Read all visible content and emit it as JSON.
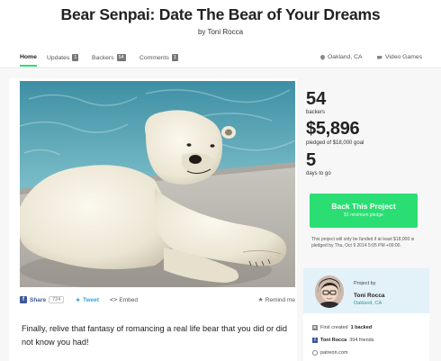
{
  "project": {
    "title": "Bear Senpai: Date The Bear of Your Dreams",
    "byline": "by Toni Rocca"
  },
  "nav": {
    "home": "Home",
    "updates": "Updates",
    "updates_count": "1",
    "backers": "Backers",
    "backers_count": "54",
    "comments": "Comments",
    "comments_count": "1",
    "location": "Oakland, CA",
    "category": "Video Games"
  },
  "stats": {
    "backers_num": "54",
    "backers_label": "backers",
    "pledged_num": "$5,896",
    "pledged_label": "pledged of $18,000 goal",
    "days_num": "5",
    "days_label": "days to go"
  },
  "back_button": {
    "label": "Back This Project",
    "sub": "$1 minimum pledge"
  },
  "funding_note": "This project will only be funded if at least $18,000 is pledged by Thu, Oct 9 2014 5:05 PM +09:00.",
  "share": {
    "facebook": "Share",
    "facebook_count": "724",
    "tweet": "Tweet",
    "embed": "Embed",
    "remind": "Remind me"
  },
  "blurb": "Finally, relive that fantasy of romancing a real life bear that you did or did not know you had!",
  "creator": {
    "project_by": "Project by",
    "name": "Toni Rocca",
    "location": "Oakland, CA",
    "first_created": "First created",
    "backed": "1 backed",
    "fb_name": "Toni Rocca",
    "fb_friends": "394 friends",
    "website": "patreon.com"
  },
  "colors": {
    "accent_green": "#2bde73",
    "facebook_blue": "#3b5998",
    "twitter_blue": "#2fa6e0",
    "creator_bg": "#e3f1f9"
  },
  "icons": [
    "pin-icon",
    "tag-icon",
    "facebook-icon",
    "twitter-icon",
    "embed-icon",
    "star-icon",
    "kickstarter-icon",
    "globe-icon"
  ]
}
